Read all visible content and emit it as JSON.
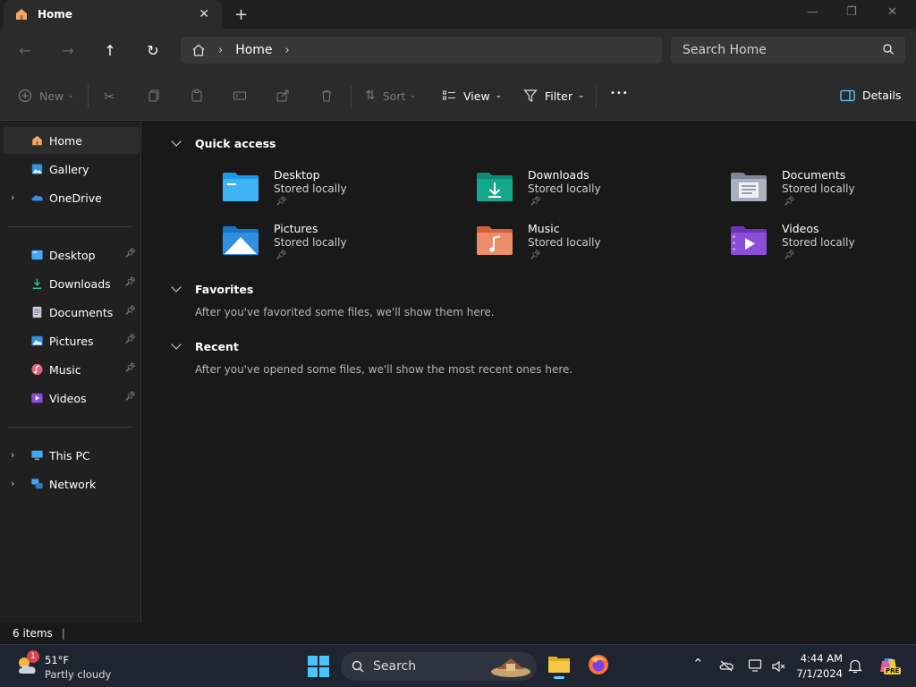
{
  "window": {
    "tab_title": "Home",
    "tab_close": "✕",
    "new_tab": "+",
    "minimize": "—",
    "maximize": "❐",
    "close": "✕"
  },
  "addressbar": {
    "back": "←",
    "forward": "→",
    "up": "↑",
    "refresh": "↻",
    "breadcrumb": [
      "Home"
    ],
    "search_placeholder": "Search Home"
  },
  "toolbar": {
    "new_label": "New",
    "sort_label": "Sort",
    "view_label": "View",
    "filter_label": "Filter",
    "more_label": "•••",
    "details_label": "Details"
  },
  "sidebar": {
    "top": [
      {
        "label": "Home",
        "icon": "home-icon",
        "selected": true
      },
      {
        "label": "Gallery",
        "icon": "gallery-icon"
      },
      {
        "label": "OneDrive",
        "icon": "onedrive-icon",
        "expandable": true
      }
    ],
    "pinned": [
      {
        "label": "Desktop",
        "icon": "desktop-icon"
      },
      {
        "label": "Downloads",
        "icon": "downloads-icon"
      },
      {
        "label": "Documents",
        "icon": "documents-icon"
      },
      {
        "label": "Pictures",
        "icon": "pictures-icon"
      },
      {
        "label": "Music",
        "icon": "music-icon"
      },
      {
        "label": "Videos",
        "icon": "videos-icon"
      }
    ],
    "bottom": [
      {
        "label": "This PC",
        "icon": "this-pc-icon"
      },
      {
        "label": "Network",
        "icon": "network-icon"
      }
    ]
  },
  "main": {
    "quick_access": {
      "title": "Quick access",
      "items": [
        {
          "name": "Desktop",
          "status": "Stored locally",
          "icon": "desktop-folder-icon"
        },
        {
          "name": "Downloads",
          "status": "Stored locally",
          "icon": "downloads-folder-icon"
        },
        {
          "name": "Documents",
          "status": "Stored locally",
          "icon": "documents-folder-icon"
        },
        {
          "name": "Pictures",
          "status": "Stored locally",
          "icon": "pictures-folder-icon"
        },
        {
          "name": "Music",
          "status": "Stored locally",
          "icon": "music-folder-icon"
        },
        {
          "name": "Videos",
          "status": "Stored locally",
          "icon": "videos-folder-icon"
        }
      ]
    },
    "favorites": {
      "title": "Favorites",
      "hint": "After you've favorited some files, we'll show them here."
    },
    "recent": {
      "title": "Recent",
      "hint": "After you've opened some files, we'll show the most recent ones here."
    }
  },
  "status": {
    "items_count": "6 items"
  },
  "taskbar": {
    "weather_badge": "1",
    "weather_temp": "51°F",
    "weather_desc": "Partly cloudy",
    "search_label": "Search",
    "time": "4:44 AM",
    "date": "7/1/2024",
    "copilot_badge": "PRE"
  },
  "colors": {
    "accent": "#60cdff",
    "folder_blue": "#1e9be8",
    "folder_green": "#13a88a",
    "folder_gray": "#9aa3b2",
    "folder_orange": "#e8805a",
    "folder_purple": "#8a4ed8"
  }
}
